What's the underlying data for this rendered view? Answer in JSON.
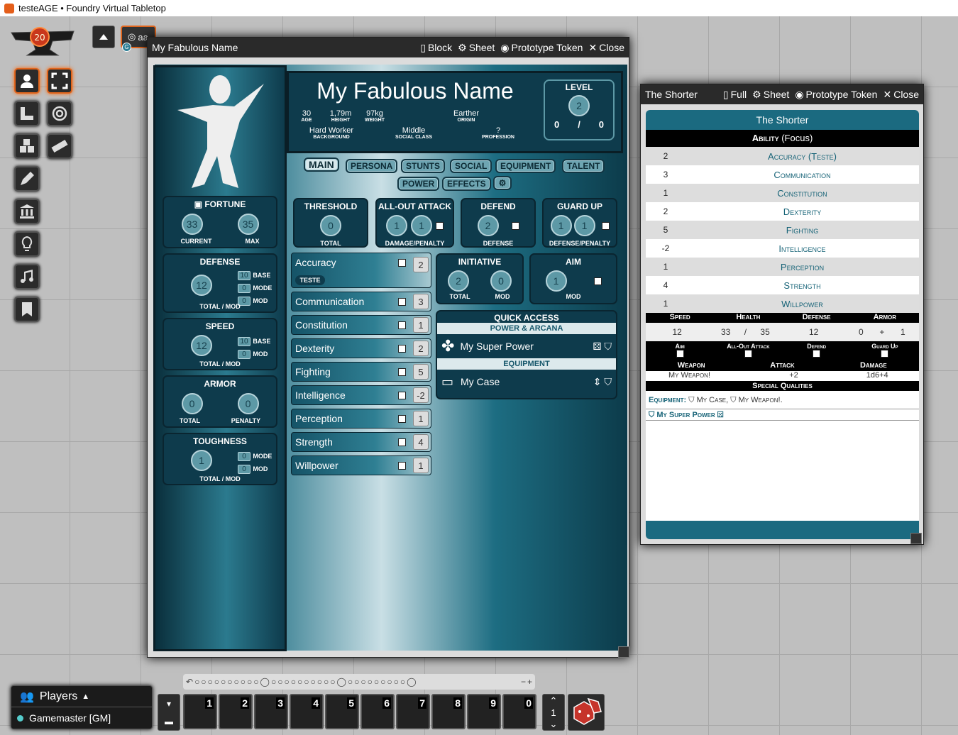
{
  "app_title": "testeAGE • Foundry Virtual Tabletop",
  "scene_tab": "aa",
  "main_sheet": {
    "title": "My Fabulous Name",
    "header_buttons": {
      "block": "Block",
      "sheet": "Sheet",
      "prototype": "Prototype Token",
      "close": "Close"
    },
    "name": "My Fabulous Name",
    "age": "30",
    "age_label": "AGE",
    "height": "1,79m",
    "height_label": "HEIGHT",
    "weight": "97kg",
    "weight_label": "WEIGHT",
    "origin": "Earther",
    "origin_label": "ORIGIN",
    "background": "Hard Worker",
    "background_label": "BACKGROUND",
    "social_class": "Middle",
    "social_class_label": "SOCIAL CLASS",
    "profession": "?",
    "profession_label": "PROFESSION",
    "level_label": "LEVEL",
    "level": "2",
    "xp_current": "0",
    "xp_sep": "/",
    "xp_next": "0",
    "tabs": [
      "MAIN",
      "PERSONA",
      "STUNTS",
      "SOCIAL",
      "EQUIPMENT",
      "TALENT",
      "POWER",
      "EFFECTS"
    ],
    "fortune": {
      "label": "FORTUNE",
      "current": "33",
      "max": "35",
      "current_label": "CURRENT",
      "max_label": "MAX"
    },
    "defense": {
      "label": "DEFENSE",
      "total": "12",
      "base": "10",
      "mode": "0",
      "mod": "0",
      "base_label": "BASE",
      "mode_label": "MODE",
      "mod_label": "MOD",
      "foot": "TOTAL / MOD"
    },
    "speed": {
      "label": "SPEED",
      "total": "12",
      "base": "10",
      "mod": "0",
      "base_label": "BASE",
      "mod_label": "MOD",
      "foot": "TOTAL / MOD"
    },
    "armor": {
      "label": "ARMOR",
      "total": "0",
      "penalty": "0",
      "total_label": "TOTAL",
      "penalty_label": "PENALTY"
    },
    "toughness": {
      "label": "TOUGHNESS",
      "total": "1",
      "mode": "0",
      "mod": "0",
      "mode_label": "MODE",
      "mod_label": "MOD",
      "foot": "TOTAL / MOD"
    },
    "threshold": {
      "label": "THRESHOLD",
      "value": "0",
      "foot": "TOTAL"
    },
    "allout": {
      "label": "ALL-OUT ATTACK",
      "a": "1",
      "b": "1",
      "foot": "DAMAGE/PENALTY"
    },
    "defend": {
      "label": "DEFEND",
      "value": "2",
      "foot": "DEFENSE"
    },
    "guardup": {
      "label": "GUARD UP",
      "a": "1",
      "b": "1",
      "foot": "DEFENSE/PENALTY"
    },
    "initiative": {
      "label": "INITIATIVE",
      "total": "2",
      "mod": "0",
      "total_label": "TOTAL",
      "mod_label": "MOD"
    },
    "aim": {
      "label": "AIM",
      "mod": "1",
      "mod_label": "MOD"
    },
    "focus_tag": "TESTE",
    "abilities": [
      {
        "name": "Accuracy",
        "value": "2"
      },
      {
        "name": "Communication",
        "value": "3"
      },
      {
        "name": "Constitution",
        "value": "1"
      },
      {
        "name": "Dexterity",
        "value": "2"
      },
      {
        "name": "Fighting",
        "value": "5"
      },
      {
        "name": "Intelligence",
        "value": "-2"
      },
      {
        "name": "Perception",
        "value": "1"
      },
      {
        "name": "Strength",
        "value": "4"
      },
      {
        "name": "Willpower",
        "value": "1"
      }
    ],
    "quick_access": {
      "label": "QUICK ACCESS",
      "power_label": "POWER & ARCANA",
      "power_item": "My Super Power",
      "equip_label": "EQUIPMENT",
      "equip_item": "My Case"
    }
  },
  "short_sheet": {
    "title": "The Shorter",
    "header_buttons": {
      "full": "Full",
      "sheet": "Sheet",
      "prototype": "Prototype Token",
      "close": "Close"
    },
    "name": "The Shorter",
    "ability_header": "Ability",
    "focus_header": "(Focus)",
    "abilities": [
      {
        "value": "2",
        "name": "Accuracy (Teste)"
      },
      {
        "value": "3",
        "name": "Communication"
      },
      {
        "value": "1",
        "name": "Constitution"
      },
      {
        "value": "2",
        "name": "Dexterity"
      },
      {
        "value": "5",
        "name": "Fighting"
      },
      {
        "value": "-2",
        "name": "Intelligence"
      },
      {
        "value": "1",
        "name": "Perception"
      },
      {
        "value": "4",
        "name": "Strength"
      },
      {
        "value": "1",
        "name": "Willpower"
      }
    ],
    "stats_headers": [
      "Speed",
      "Health",
      "Defense",
      "Armor"
    ],
    "speed": "12",
    "health": "33",
    "health_sep": "/",
    "health_max": "35",
    "defense": "12",
    "armor": "0",
    "armor_plus": "+",
    "armor_mod": "1",
    "action_headers": [
      "Aim",
      "All-Out Attack",
      "Defend",
      "Guard Up"
    ],
    "weapon_headers": [
      "Weapon",
      "Attack",
      "Damage"
    ],
    "weapon": {
      "name": "My Weapon!",
      "attack": "+2",
      "damage": "1d6+4"
    },
    "special_label": "Special Qualities",
    "equipment_label": "Equipment:",
    "equipment_items": [
      "My Case,",
      "My Weapon!."
    ],
    "power_item": "My Super Power"
  },
  "players": {
    "label": "Players",
    "gm": "Gamemaster [GM]"
  },
  "hotbar": {
    "slots": [
      "1",
      "2",
      "3",
      "4",
      "5",
      "6",
      "7",
      "8",
      "9",
      "0"
    ],
    "page": "1"
  }
}
